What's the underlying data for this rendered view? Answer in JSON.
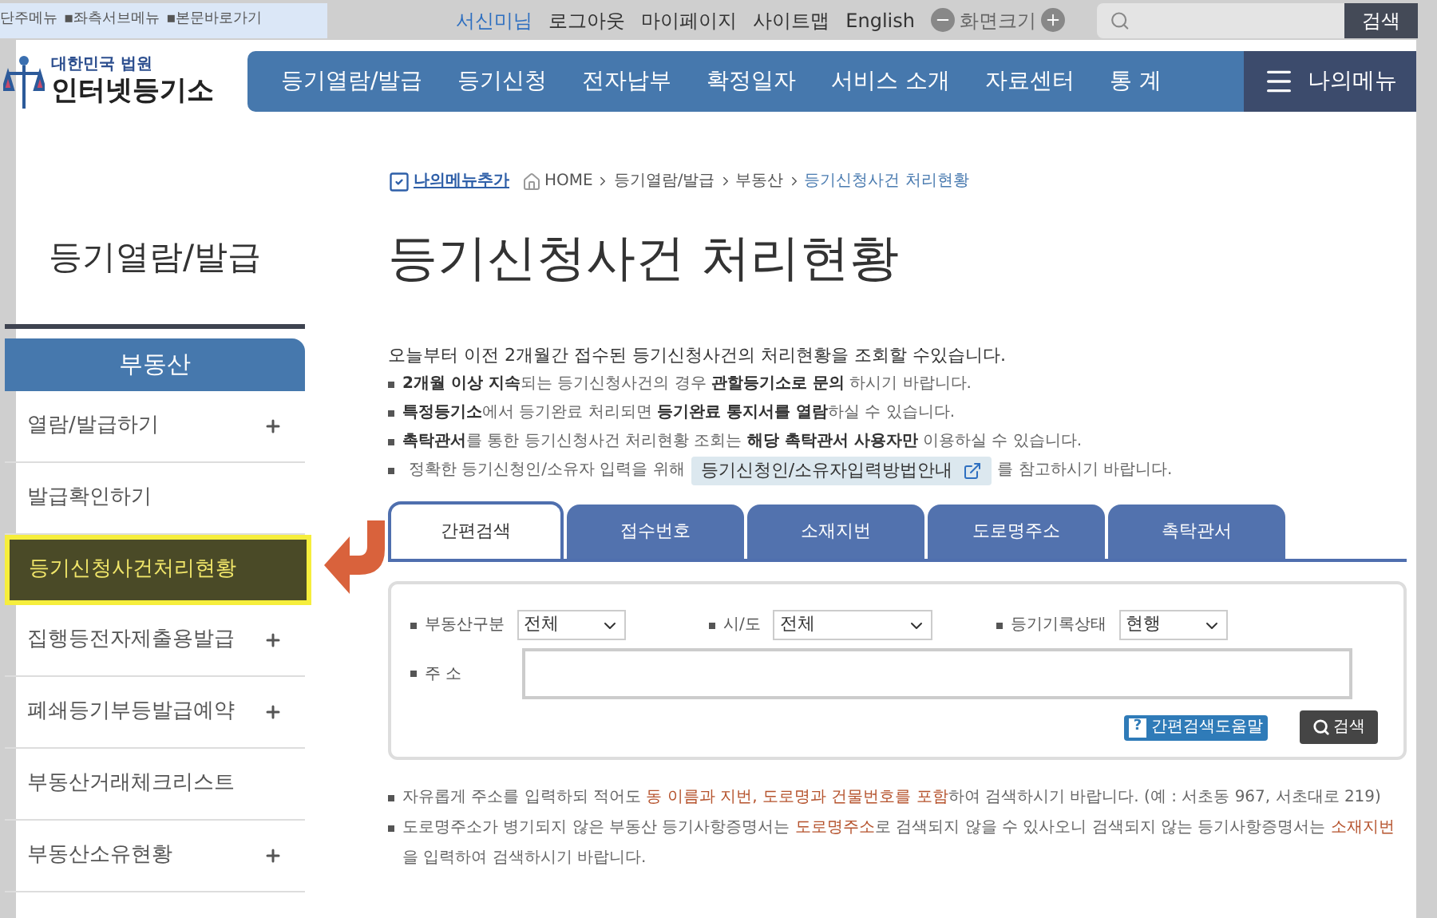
{
  "skip_links": [
    "단주메뉴",
    "▪좌측서브메뉴",
    "▪본문바로가기"
  ],
  "util": {
    "user": "서신미님",
    "links": [
      "로그아웃",
      "마이페이지",
      "사이트맵",
      "English"
    ],
    "font_size_label": "화면크기",
    "search_button": "검색"
  },
  "logo": {
    "top": "대한민국 법원",
    "name": "인터넷등기소"
  },
  "nav": [
    "등기열람/발급",
    "등기신청",
    "전자납부",
    "확정일자",
    "서비스 소개",
    "자료센터",
    "통 계"
  ],
  "my_menu": "나의메뉴",
  "sidebar": {
    "title": "등기열람/발급",
    "section": "부동산",
    "items": [
      {
        "label": "열람/발급하기",
        "expandable": true,
        "selected": false
      },
      {
        "label": "발급확인하기",
        "expandable": false,
        "selected": false
      },
      {
        "label": "등기신청사건처리현황",
        "expandable": false,
        "selected": true
      },
      {
        "label": "집행등전자제출용발급",
        "expandable": true,
        "selected": false
      },
      {
        "label": "폐쇄등기부등발급예약",
        "expandable": true,
        "selected": false
      },
      {
        "label": "부동산거래체크리스트",
        "expandable": false,
        "selected": false
      },
      {
        "label": "부동산소유현황",
        "expandable": true,
        "selected": false
      }
    ]
  },
  "breadcrumb": {
    "add_menu": "나의메뉴추가",
    "items": [
      "HOME",
      "등기열람/발급",
      "부동산",
      "등기신청사건 처리현황"
    ]
  },
  "page_title": "등기신청사건 처리현황",
  "intro": "오늘부터 이전 2개월간 접수된 등기신청사건의 처리현황을 조회할 수있습니다.",
  "bullets": [
    [
      {
        "kind": "bold",
        "text": "2개월 이상 지속"
      },
      {
        "kind": "plain",
        "text": "되는 등기신청사건의 경우 "
      },
      {
        "kind": "bold",
        "text": "관할등기소로 문의"
      },
      {
        "kind": "plain",
        "text": " 하시기 바랍니다."
      }
    ],
    [
      {
        "kind": "bold",
        "text": "특정등기소"
      },
      {
        "kind": "plain",
        "text": "에서 등기완료 처리되면 "
      },
      {
        "kind": "bold",
        "text": "등기완료 통지서를 열람"
      },
      {
        "kind": "plain",
        "text": "하실 수 있습니다."
      }
    ],
    [
      {
        "kind": "bold",
        "text": "촉탁관서"
      },
      {
        "kind": "plain",
        "text": "를 통한 등기신청사건 처리현황 조회는 "
      },
      {
        "kind": "bold",
        "text": "해당 촉탁관서 사용자만"
      },
      {
        "kind": "plain",
        "text": " 이용하실 수 있습니다."
      }
    ]
  ],
  "guide": {
    "before": "정확한 등기신청인/소유자 입력을 위해",
    "link": "등기신청인/소유자입력방법안내",
    "after": "를 참고하시기 바랍니다."
  },
  "tabs": [
    {
      "label": "간편검색",
      "selected": true
    },
    {
      "label": "접수번호",
      "selected": false
    },
    {
      "label": "소재지번",
      "selected": false
    },
    {
      "label": "도로명주소",
      "selected": false
    },
    {
      "label": "촉탁관서",
      "selected": false
    }
  ],
  "form": {
    "selects": [
      {
        "label": "부동산구분",
        "value": "전체"
      },
      {
        "label": "시/도",
        "value": "전체"
      },
      {
        "label": "등기기록상태",
        "value": "현행"
      }
    ],
    "address_label": "주 소",
    "help_icon": "?",
    "help_button": "간편검색도움말",
    "search_button": "검색"
  },
  "notes": [
    [
      {
        "kind": "plain",
        "text": "자유롭게 주소를 입력하되 적어도 "
      },
      {
        "kind": "red",
        "text": "동 이름과 지번, 도로명과 건물번호를 포함"
      },
      {
        "kind": "plain",
        "text": "하여 검색하시기 바랍니다. (예 : 서초동 967, 서초대로 219)"
      }
    ],
    [
      {
        "kind": "plain",
        "text": "도로명주소가 병기되지 않은 부동산 등기사항증명서는 "
      },
      {
        "kind": "red",
        "text": "도로명주소"
      },
      {
        "kind": "plain",
        "text": "로 검색되지 않을 수 있사오니 검색되지 않는 등기사항증명서는 "
      },
      {
        "kind": "red",
        "text": "소재지번"
      },
      {
        "kind": "plain",
        "text": "을 입력하여 검색하시기 바랍니다."
      }
    ]
  ]
}
